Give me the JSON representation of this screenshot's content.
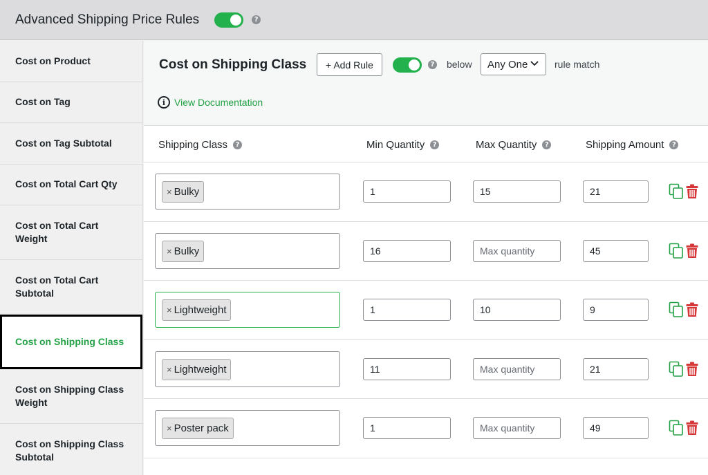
{
  "header": {
    "title": "Advanced Shipping Price Rules",
    "enabled": true
  },
  "sidebar": {
    "items": [
      {
        "label": "Cost on Product",
        "active": false
      },
      {
        "label": "Cost on Tag",
        "active": false
      },
      {
        "label": "Cost on Tag Subtotal",
        "active": false
      },
      {
        "label": "Cost on Total Cart Qty",
        "active": false
      },
      {
        "label": "Cost on Total Cart Weight",
        "active": false
      },
      {
        "label": "Cost on Total Cart Subtotal",
        "active": false
      },
      {
        "label": "Cost on Shipping Class",
        "active": true
      },
      {
        "label": "Cost on Shipping Class Weight",
        "active": false
      },
      {
        "label": "Cost on Shipping Class Subtotal",
        "active": false
      }
    ]
  },
  "main": {
    "title": "Cost on Shipping Class",
    "add_rule_label": "+ Add Rule",
    "below_label": "below",
    "match_select": "Any One",
    "rule_match_label": "rule match",
    "doc_link": "View Documentation",
    "columns": {
      "shipping_class": "Shipping Class",
      "min_qty": "Min Quantity",
      "max_qty": "Max Quantity",
      "amount": "Shipping Amount"
    },
    "max_placeholder": "Max quantity",
    "rows": [
      {
        "tag": "Bulky",
        "min": "1",
        "max": "15",
        "amount": "21"
      },
      {
        "tag": "Bulky",
        "min": "16",
        "max": "",
        "amount": "45"
      },
      {
        "tag": "Lightweight",
        "min": "1",
        "max": "10",
        "amount": "9"
      },
      {
        "tag": "Lightweight",
        "min": "11",
        "max": "",
        "amount": "21"
      },
      {
        "tag": "Poster pack",
        "min": "1",
        "max": "",
        "amount": "49"
      }
    ]
  },
  "colors": {
    "accent": "#22a245",
    "delete": "#d63638"
  }
}
